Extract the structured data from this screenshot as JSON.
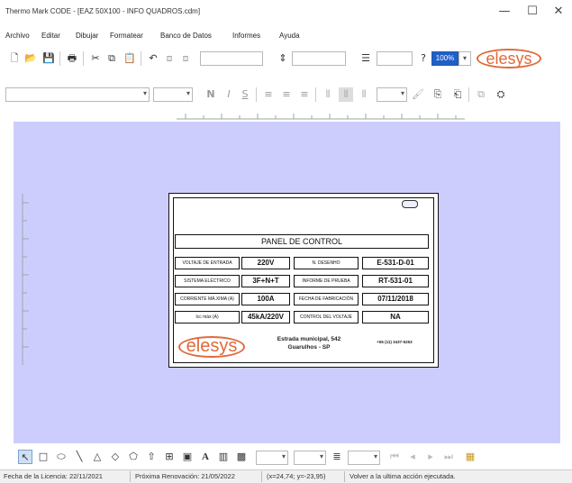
{
  "window": {
    "title": "Thermo Mark CODE - [EAZ 50X100 - INFO QUADROS.cdm]",
    "minimize": "—",
    "maximize": "☐",
    "close": "✕"
  },
  "menu": [
    "Archivo",
    "Editar",
    "Dibujar",
    "Formatear",
    "Banco de Datos",
    "Informes",
    "Ayuda"
  ],
  "toolbar": {
    "zoom": "100%",
    "logo_text": "elesys"
  },
  "label": {
    "panel_title": "PANEL DE CONTROL",
    "rows": [
      {
        "left_label": "VOLTAJE DE ENTRADA",
        "left_value": "220V",
        "right_label": "N. DESENHO",
        "right_value": "E-531-D-01"
      },
      {
        "left_label": "SISTEMA ELÉCTRICO",
        "left_value": "3F+N+T",
        "right_label": "INFORME DE PRUEBA",
        "right_value": "RT-531-01"
      },
      {
        "left_label": "CORRIENTE MÁ.XIMA (A)",
        "left_value": "100A",
        "right_label": "FECHA DE FABRICACIÓN",
        "right_value": "07/11/2018"
      },
      {
        "left_label": "Icc máx (A)",
        "left_value": "45kA/220V",
        "right_label": "CONTROL DEL VOLTAJE",
        "right_value": "NA"
      }
    ],
    "logo_text": "elesys",
    "address_line1": "Estrada municipal, 542",
    "address_line2": "Guarulhos - SP",
    "phone": "+55 (11) 3437-5253"
  },
  "status": {
    "license": "Fecha de la Licencia: 22/11/2021",
    "renewal": "Próxima Renovación: 21/05/2022",
    "coords": "(x=24,74; y=-23,95)",
    "hint": "Volver a la ultima acción ejecutada."
  }
}
